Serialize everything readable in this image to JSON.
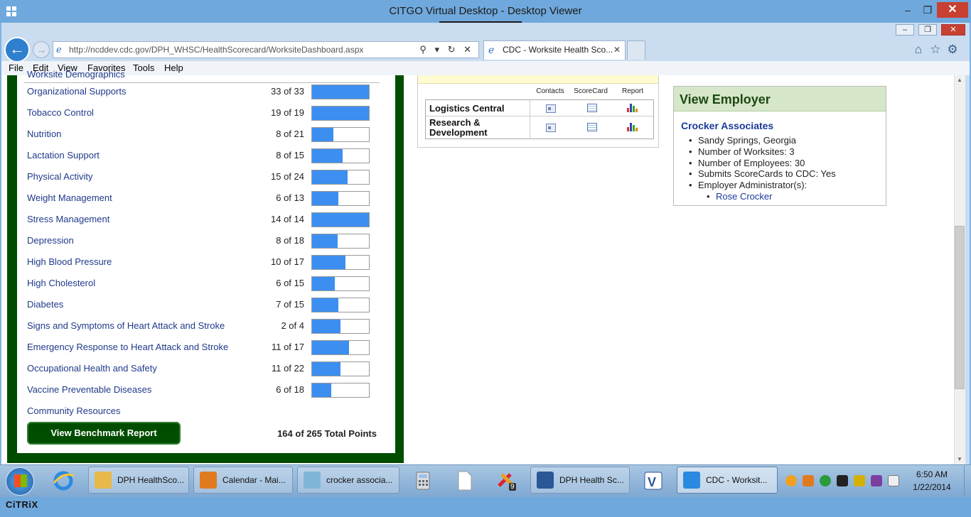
{
  "citrix": {
    "title": "CITGO Virtual Desktop - Desktop Viewer",
    "minimize": "‒",
    "restore": "❐",
    "close": "✕",
    "dropdown": "▪▪▪▪▪▪ ⬇ ▪▪▪▪▪▪",
    "logo": "CiTRiX"
  },
  "browser": {
    "url": "http://ncddev.cdc.gov/DPH_WHSC/HealthScorecard/WorksiteDashboard.aspx",
    "address_tools": "⚲ ▾ ↻ ✕",
    "tab_title": "CDC - Worksite Health Sco...",
    "tab_close": "✕",
    "menu": {
      "file": "File",
      "edit": "Edit",
      "view": "View",
      "favorites": "Favorites",
      "tools": "Tools",
      "help": "Help"
    },
    "icons": [
      "home-icon",
      "star-icon",
      "gear-icon"
    ]
  },
  "dashboard": {
    "section_title": "Worksite Demographics",
    "rows": [
      {
        "label": "Organizational Supports",
        "score": "33 of 33",
        "fraction": 1.0
      },
      {
        "label": "Tobacco Control",
        "score": "19 of 19",
        "fraction": 1.0
      },
      {
        "label": "Nutrition",
        "score": "8 of 21",
        "fraction": 0.381
      },
      {
        "label": "Lactation Support",
        "score": "8 of 15",
        "fraction": 0.533
      },
      {
        "label": "Physical Activity",
        "score": "15 of 24",
        "fraction": 0.625
      },
      {
        "label": "Weight Management",
        "score": "6 of 13",
        "fraction": 0.462
      },
      {
        "label": "Stress Management",
        "score": "14 of 14",
        "fraction": 1.0
      },
      {
        "label": "Depression",
        "score": "8 of 18",
        "fraction": 0.444
      },
      {
        "label": "High Blood Pressure",
        "score": "10 of 17",
        "fraction": 0.588
      },
      {
        "label": "High Cholesterol",
        "score": "6 of 15",
        "fraction": 0.4
      },
      {
        "label": "Diabetes",
        "score": "7 of 15",
        "fraction": 0.467
      },
      {
        "label": "Signs and Symptoms of Heart Attack and Stroke",
        "score": "2 of 4",
        "fraction": 0.5
      },
      {
        "label": "Emergency Response to Heart Attack and Stroke",
        "score": "11 of 17",
        "fraction": 0.647
      },
      {
        "label": "Occupational Health and Safety",
        "score": "11 of 22",
        "fraction": 0.5
      },
      {
        "label": "Vaccine Preventable Diseases",
        "score": "6 of 18",
        "fraction": 0.333
      },
      {
        "label": "Community Resources",
        "score": "",
        "fraction": null
      }
    ],
    "benchmark_button": "View Benchmark Report",
    "total_points": "164 of 265 Total Points"
  },
  "worksites": {
    "headers": {
      "contacts": "Contacts",
      "scorecard": "ScoreCard",
      "report": "Report"
    },
    "rows": [
      {
        "name": "Logistics Central"
      },
      {
        "name": "Research & Development"
      }
    ]
  },
  "employer": {
    "heading": "View Employer",
    "name": "Crocker Associates",
    "location": "Sandy Springs, Georgia",
    "worksites": "Number of Worksites: 3",
    "employees": "Number of Employees: 30",
    "submits": "Submits ScoreCards to CDC: Yes",
    "admin_label": "Employer Administrator(s):",
    "admin_name": "Rose Crocker"
  },
  "taskbar": {
    "items": [
      {
        "label": "DPH HealthSco...",
        "icon": "folder-icon",
        "color": "#e8b84a"
      },
      {
        "label": "Calendar - Mai...",
        "icon": "outlook-icon",
        "color": "#e07a1f"
      },
      {
        "label": "crocker associa...",
        "icon": "notepad-icon",
        "color": "#7fb6d8"
      },
      {
        "label": "DPH Health Sc...",
        "icon": "word-icon",
        "color": "#2b5797"
      },
      {
        "label": "CDC - Worksit...",
        "icon": "ie-icon",
        "color": "#2a8ae0"
      }
    ],
    "time": "6:50 AM",
    "date": "1/22/2014",
    "badge": "9"
  }
}
